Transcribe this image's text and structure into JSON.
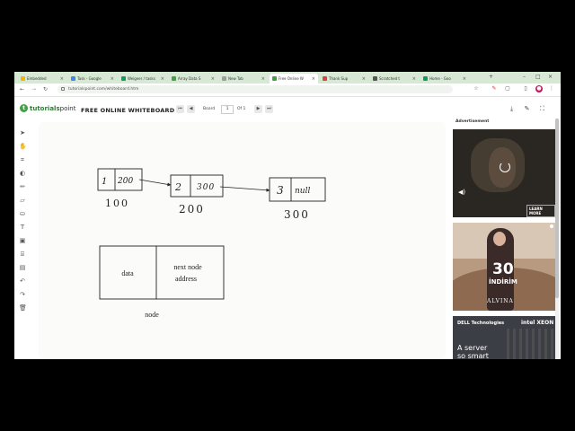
{
  "browser": {
    "tabs": [
      {
        "label": "Embedded",
        "color": "#f4b400"
      },
      {
        "label": "Task - Google",
        "color": "#4285f4"
      },
      {
        "label": "Weigeer / tasks",
        "color": "#0f9d58"
      },
      {
        "label": "Array Data S",
        "color": "#43a047"
      },
      {
        "label": "New Tab",
        "color": "#9e9e9e"
      },
      {
        "label": "Free Online W",
        "color": "#43a047",
        "active": true
      },
      {
        "label": "Thank Sup",
        "color": "#db4437"
      },
      {
        "label": "Scratched t",
        "color": "#555555"
      },
      {
        "label": "Home - Goo",
        "color": "#0f9d58"
      }
    ],
    "url": "tutorialspoint.com/whiteboard.htm"
  },
  "header": {
    "logo_mark": "t",
    "logo_brand": "tutorials",
    "logo_suffix": "point",
    "title": "FREE ONLINE WHITEBOARD",
    "board_label": "Board",
    "page_current": "1",
    "page_total_label": "Of 1"
  },
  "board": {
    "node1": {
      "value": "1",
      "next": "200",
      "address": "100"
    },
    "node2": {
      "value": "2",
      "next": "300",
      "address": "200"
    },
    "node3": {
      "value": "3",
      "next": "null",
      "address": "300"
    },
    "diagram": {
      "left": "data",
      "right_line1": "next node",
      "right_line2": "address",
      "caption": "node"
    }
  },
  "ads": {
    "label": "Advertisement",
    "video_cta": "LEARN MORE",
    "banner_big": "30",
    "banner_sub": "İNDİRİM",
    "banner_brand": "ALVINA",
    "dell": "DELL Technologies",
    "intel": "intel XEON",
    "tagline_line1": "A server",
    "tagline_line2": "so smart"
  },
  "colors": {
    "brand_green": "#43a047",
    "tab_strip": "#d7e8d5"
  }
}
